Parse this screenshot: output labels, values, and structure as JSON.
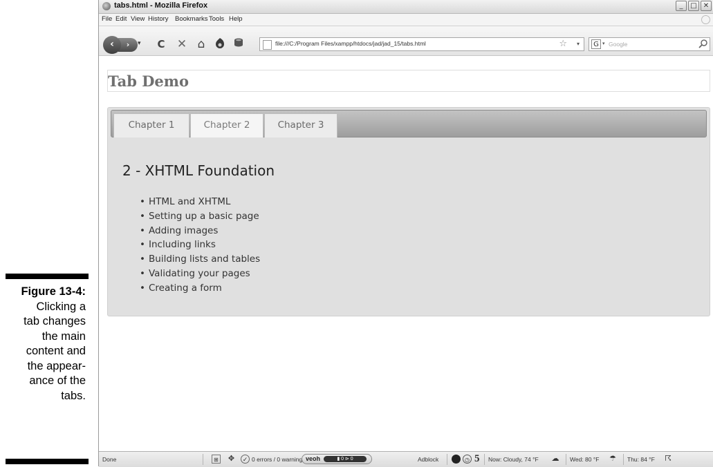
{
  "caption": {
    "label": "Figure 13-4:",
    "lines": [
      "Clicking a",
      "tab changes",
      "the main",
      "content and",
      "the appear-",
      "ance of the",
      "tabs."
    ]
  },
  "window": {
    "title": "tabs.html - Mozilla Firefox",
    "controls": {
      "minimize": "_",
      "maximize": "□",
      "close": "✕"
    }
  },
  "menubar": {
    "items": [
      "File",
      "Edit",
      "View",
      "History",
      "Bookmarks",
      "Tools",
      "Help"
    ]
  },
  "navbar": {
    "back_glyph": "‹",
    "forward_glyph": "›",
    "dropdown_glyph": "▾",
    "reload_glyph": "C",
    "stop_glyph": "✕",
    "home_glyph": "⌂",
    "url": "file:///C:/Program Files/xampp/htdocs/jad/jad_15/tabs.html",
    "star_glyph": "☆",
    "search_engine": "G",
    "search_placeholder": "Google",
    "search_glyph": "⚲"
  },
  "page": {
    "heading": "Tab Demo",
    "tabs": [
      "Chapter 1",
      "Chapter 2",
      "Chapter 3"
    ],
    "active_tab_index": 1,
    "panel_title": "2 - XHTML Foundation",
    "items": [
      "HTML and XHTML",
      "Setting up a basic page",
      "Adding images",
      "Including links",
      "Building lists and tables",
      "Validating your pages",
      "Creating a form"
    ]
  },
  "statusbar": {
    "status": "Done",
    "validator": "0 errors / 0 warnings",
    "veoh_logo": "veoh",
    "veoh_counts": "▮ 0  ⊳ 0",
    "adblock": "Adblock",
    "counter": "5",
    "weather_now": "Now: Cloudy, 74 °F",
    "weather_wed": "Wed: 80 °F",
    "weather_thu": "Thu: 84 °F"
  }
}
